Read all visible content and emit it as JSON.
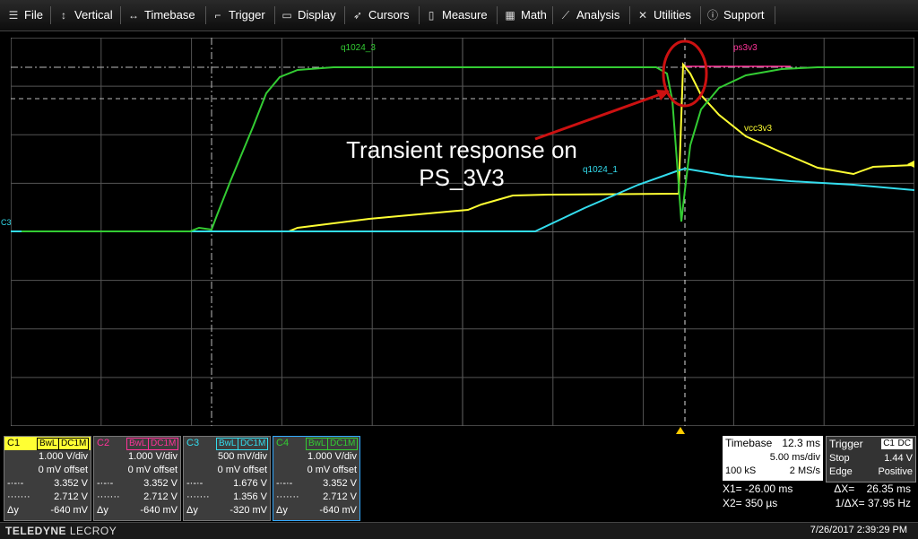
{
  "menu": [
    {
      "label": "File",
      "icon": "file-icon"
    },
    {
      "label": "Vertical",
      "icon": "vertical-icon"
    },
    {
      "label": "Timebase",
      "icon": "timebase-icon"
    },
    {
      "label": "Trigger",
      "icon": "trigger-icon"
    },
    {
      "label": "Display",
      "icon": "display-icon"
    },
    {
      "label": "Cursors",
      "icon": "cursors-icon"
    },
    {
      "label": "Measure",
      "icon": "measure-icon"
    },
    {
      "label": "Math",
      "icon": "math-icon"
    },
    {
      "label": "Analysis",
      "icon": "analysis-icon"
    },
    {
      "label": "Utilities",
      "icon": "utilities-icon"
    },
    {
      "label": "Support",
      "icon": "support-icon"
    }
  ],
  "colors": {
    "c1": "#ffff33",
    "c2": "#ff3399",
    "c3": "#33ddee",
    "c4": "#33cc33",
    "annotation_ring": "#cc1111"
  },
  "annotation": {
    "line1": "Transient response on",
    "line2": "PS_3V3"
  },
  "trace_labels": {
    "q1024_3": "q1024_3",
    "ps3v3": "ps3v3",
    "vcc3v3": "vcc3v3",
    "q1024_1": "q1024_1",
    "c3": "C3"
  },
  "channels": [
    {
      "name": "C1",
      "bw": "BwL",
      "coupling": "DC1M",
      "vdiv": "1.000 V/div",
      "offset": "0 mV offset",
      "cur1": "3.352 V",
      "cur2": "2.712 V",
      "dy_label": "Δy",
      "dy": "-640 mV"
    },
    {
      "name": "C2",
      "bw": "BwL",
      "coupling": "DC1M",
      "vdiv": "1.000 V/div",
      "offset": "0 mV offset",
      "cur1": "3.352 V",
      "cur2": "2.712 V",
      "dy_label": "Δy",
      "dy": "-640 mV"
    },
    {
      "name": "C3",
      "bw": "BwL",
      "coupling": "DC1M",
      "vdiv": "500 mV/div",
      "offset": "0 mV offset",
      "cur1": "1.676 V",
      "cur2": "1.356 V",
      "dy_label": "Δy",
      "dy": "-320 mV"
    },
    {
      "name": "C4",
      "bw": "BwL",
      "coupling": "DC1M",
      "vdiv": "1.000 V/div",
      "offset": "0 mV offset",
      "cur1": "3.352 V",
      "cur2": "2.712 V",
      "dy_label": "Δy",
      "dy": "-640 mV"
    }
  ],
  "timebase": {
    "label": "Timebase",
    "delay": "12.3 ms",
    "tdiv": "5.00 ms/div",
    "samples": "100 kS",
    "rate": "2 MS/s"
  },
  "trigger": {
    "label": "Trigger",
    "source": "C1",
    "coupling": "DC",
    "mode": "Stop",
    "level": "1.44 V",
    "type": "Edge",
    "slope": "Positive"
  },
  "cursors": {
    "x1": "X1= -26.00 ms",
    "dx": "ΔX=    26.35 ms",
    "x2": "X2= 350 µs",
    "inv_dx": "1/ΔX= 37.95 Hz"
  },
  "footer": {
    "brand1": "TELEDYNE",
    "brand2": "LECROY",
    "datetime": "7/26/2017 2:39:29 PM"
  }
}
